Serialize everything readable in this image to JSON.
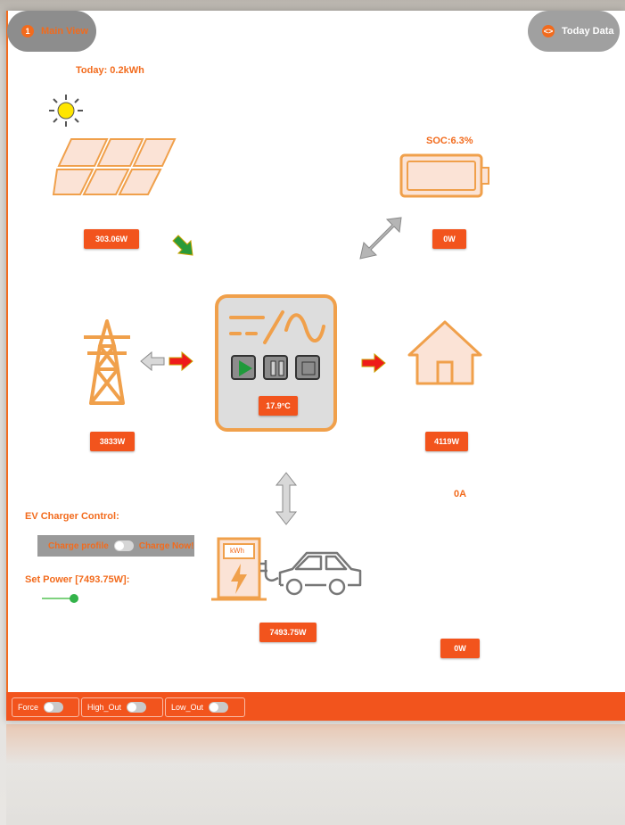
{
  "header": {
    "main_view_label": "Main View",
    "main_view_number": "1",
    "today_data_label": "Today Data",
    "today_data_icon": "code-icon"
  },
  "solar": {
    "today_label": "Today: 0.2kWh",
    "power": "303.06W"
  },
  "battery": {
    "soc_label": "SOC:6.3%",
    "power": "0W"
  },
  "grid": {
    "power": "3833W"
  },
  "inverter": {
    "temperature": "17.9°C"
  },
  "house": {
    "power": "4119W"
  },
  "ev": {
    "current": "0A",
    "control_title": "EV Charger Control:",
    "charge_profile_label": "Charge profile",
    "charge_now_label": "Charge Now!",
    "set_power_label": "Set Power [7493.75W]:",
    "power": "7493.75W",
    "secondary_power": "0W",
    "kwh_label": "kWh"
  },
  "bottom_bar": {
    "force_label": "Force",
    "high_out_label": "High_Out",
    "low_out_label": "Low_Out"
  },
  "colors": {
    "accent": "#f26b1d",
    "badge": "#f2541d",
    "flow_active": "#ee1b1b",
    "flow_solar": "#2a9a3a",
    "flow_idle": "#b5b5b5"
  }
}
